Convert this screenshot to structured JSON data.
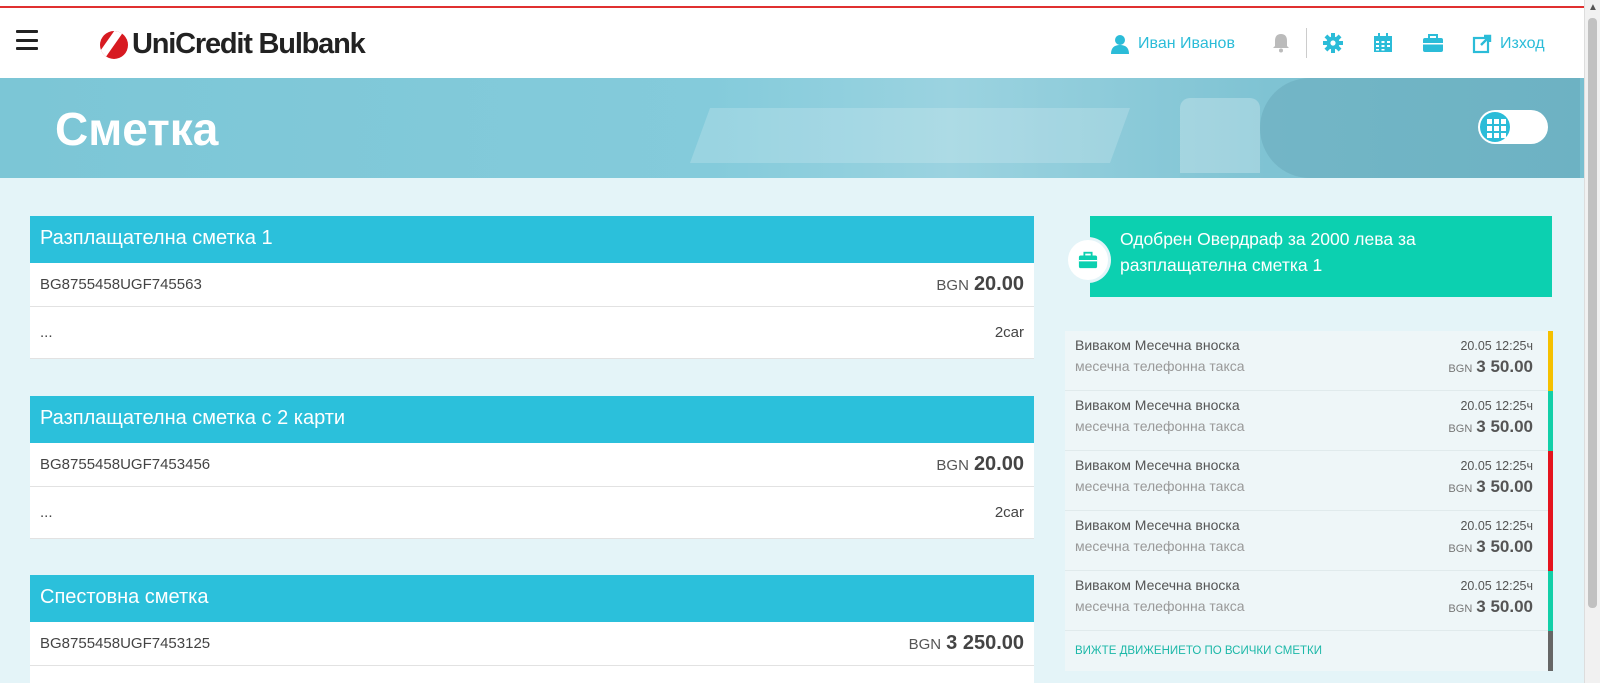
{
  "header": {
    "logo_text": "UniCredit Bulbank",
    "user_name": "Иван Иванов",
    "logout_label": "Изход",
    "icons": [
      "menu-icon",
      "user-icon",
      "bell-icon",
      "gear-icon",
      "calendar-icon",
      "briefcase-icon",
      "external-link-icon"
    ]
  },
  "hero": {
    "title": "Сметка"
  },
  "accounts": [
    {
      "name": "Разплащателна сметка 1",
      "iban": "BG8755458UGF745563",
      "currency": "BGN",
      "balance": "20.00",
      "extra_left": "...",
      "extra_right": "2car"
    },
    {
      "name": "Разплащателна сметка с 2 карти",
      "iban": "BG8755458UGF7453456",
      "currency": "BGN",
      "balance": "20.00",
      "extra_left": "...",
      "extra_right": "2car"
    },
    {
      "name": "Спестовна сметка",
      "iban": "BG8755458UGF7453125",
      "currency": "BGN",
      "balance": "3 250.00"
    }
  ],
  "promo": {
    "text": "Одобрен Овердраф за 2000 лева за разплащателна сметка 1"
  },
  "transactions": [
    {
      "title": "Виваком Месечна вноска",
      "subtitle": "месечна телефонна такса",
      "date": "20.05 12:25ч",
      "currency": "BGN",
      "amount": "3 50.00",
      "status_color": "#f5c000"
    },
    {
      "title": "Виваком Месечна вноска",
      "subtitle": "месечна телефонна такса",
      "date": "20.05 12:25ч",
      "currency": "BGN",
      "amount": "3 50.00",
      "status_color": "#12cfa8"
    },
    {
      "title": "Виваком Месечна вноска",
      "subtitle": "месечна телефонна такса",
      "date": "20.05 12:25ч",
      "currency": "BGN",
      "amount": "3 50.00",
      "status_color": "#e4141e"
    },
    {
      "title": "Виваком Месечна вноска",
      "subtitle": "месечна телефонна такса",
      "date": "20.05 12:25ч",
      "currency": "BGN",
      "amount": "3 50.00",
      "status_color": "#e4141e"
    },
    {
      "title": "Виваком Месечна вноска",
      "subtitle": "месечна телефонна такса",
      "date": "20.05 12:25ч",
      "currency": "BGN",
      "amount": "3 50.00",
      "status_color": "#12cfa8"
    }
  ],
  "see_all_label": "ВИЖТЕ ДВИЖЕНИЕТО ПО ВСИЧКИ СМЕТКИ",
  "colors": {
    "accent": "#2bc0db",
    "promo": "#0cd0b0",
    "background": "#e4f4f8"
  }
}
